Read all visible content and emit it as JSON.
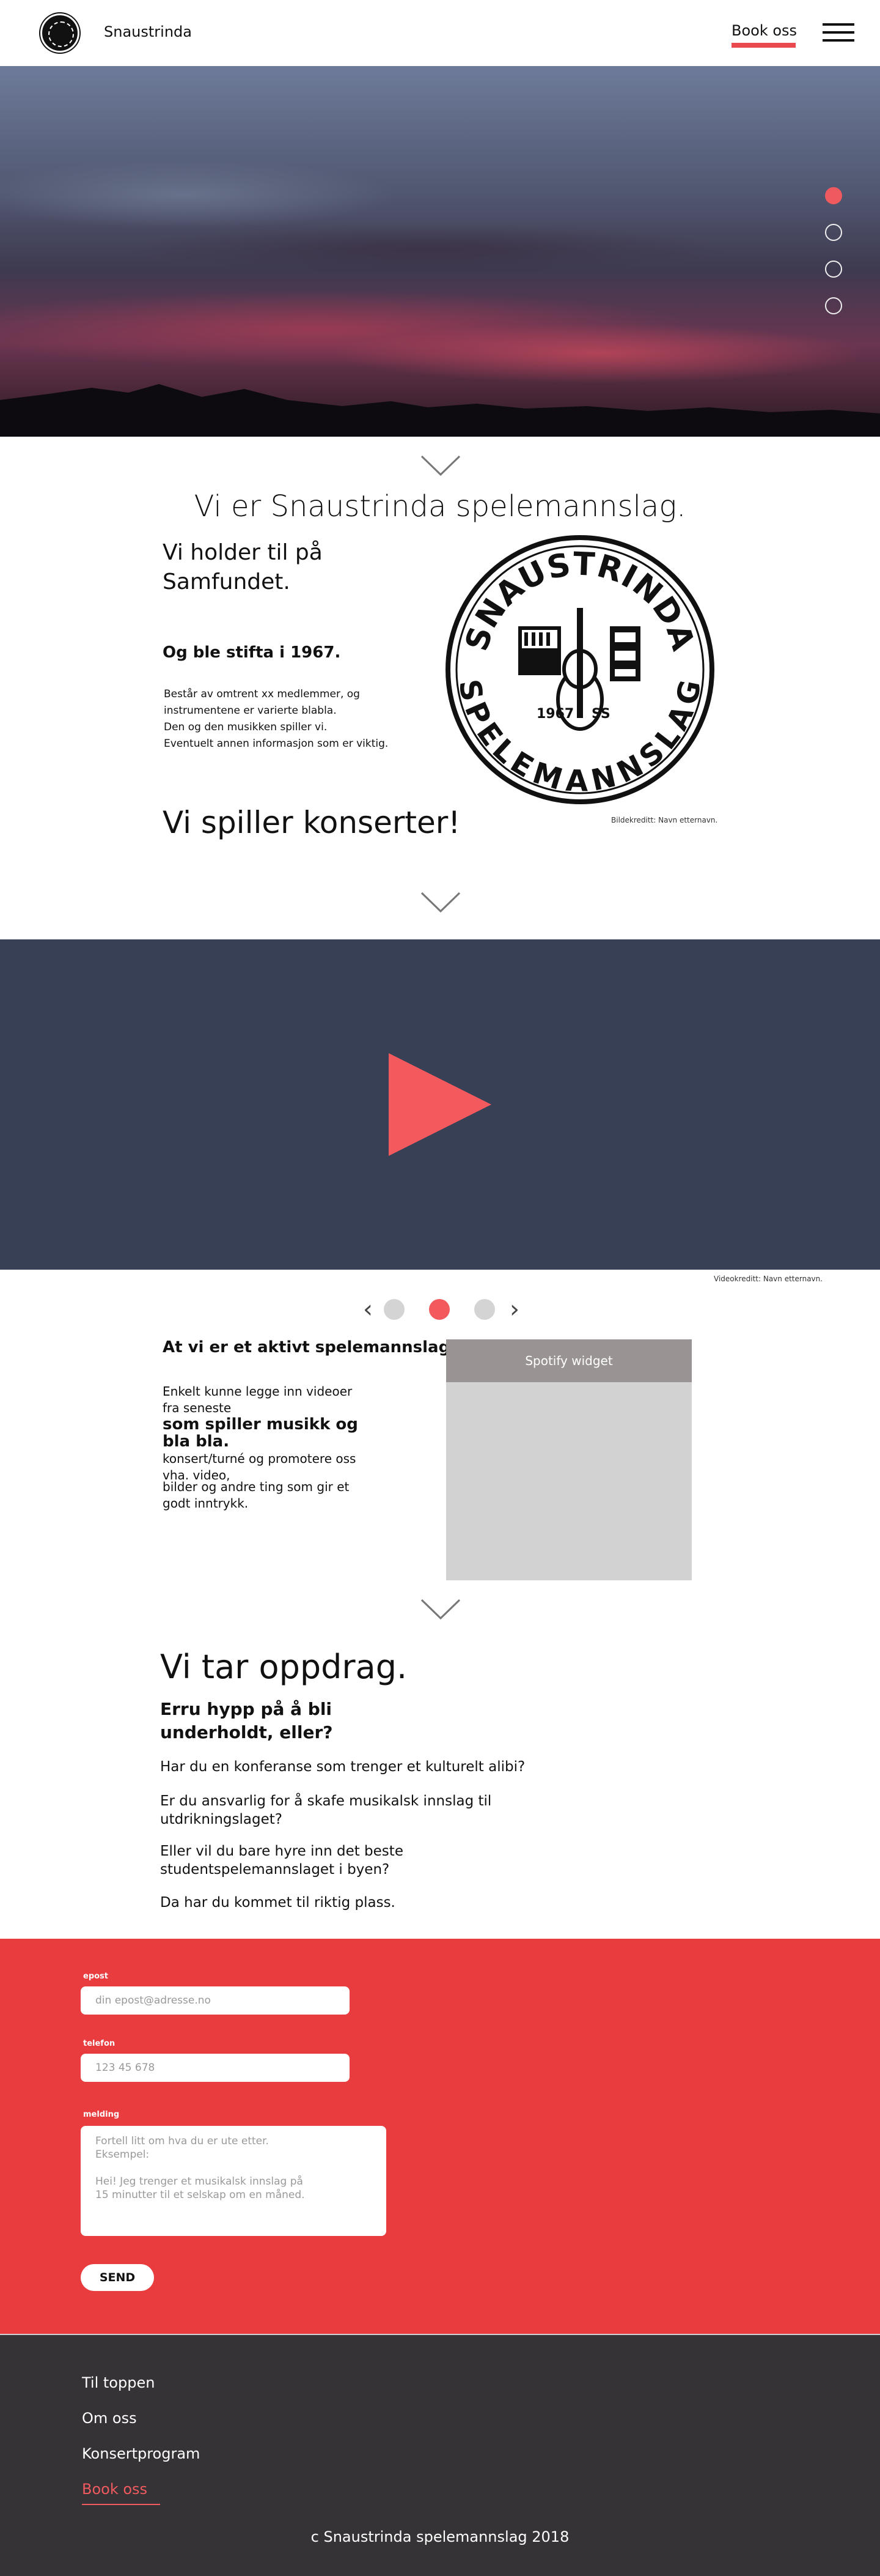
{
  "header": {
    "brand": "Snaustrinda",
    "book_label": "Book oss",
    "accent": "#e94a4f"
  },
  "hero": {
    "slide_count": 4,
    "active_slide": 1
  },
  "about": {
    "title": "Vi er Snaustrinda spelemannslag.",
    "subtitle": "Vi holder til på Samfundet.",
    "founded": "Og ble stifta i 1967.",
    "lines": [
      "Består av omtrent xx medlemmer, og",
      "instrumentene er varierte blabla.",
      "Den og den musikken spiller vi.",
      "Eventuelt annen informasjon som er viktig."
    ],
    "image_credit": "Bildekreditt: Navn etternavn.",
    "concerts": "Vi spiller konserter!",
    "seal": {
      "top_text": "SNAUSTRINDA",
      "bottom_text": "SPELEMANNSLAG",
      "year": "1967",
      "initials": "SS"
    }
  },
  "video": {
    "background": "#374055",
    "play_color": "#f25a5d",
    "credit": "Videokreditt: Navn etternavn.",
    "carousel_count": 3,
    "carousel_active": 2
  },
  "active": {
    "title": "At vi er et aktivt spelemannslag",
    "line1": "Enkelt kunne legge inn videoer",
    "line2": "fra seneste",
    "bold": "som spiller musikk og  bla bla.",
    "line3": "konsert/turné og promotere oss",
    "line4": "vha. video,",
    "line5": "bilder og andre ting som gir et",
    "line6": "godt inntrykk.",
    "spotify_label": "Spotify widget"
  },
  "oppdrag": {
    "title": "Vi tar oppdrag.",
    "subtitle": "Erru hypp på å bli underholdt, eller?",
    "p1": "Har du en konferanse som trenger et kulturelt alibi?",
    "p2": "Er du ansvarlig for å skafe musikalsk innslag til utdrikningslaget?",
    "p3": "Eller vil du bare hyre inn det beste studentspelemannslaget i byen?",
    "p4": "Da har du kommet til riktig plass."
  },
  "form": {
    "background": "#e83c3f",
    "email_label": "epost",
    "email_placeholder": "din epost@adresse.no",
    "phone_label": "telefon",
    "phone_placeholder": "123 45 678",
    "message_label": "melding",
    "message_placeholder": "Fortell litt om hva du er ute etter.\nEksempel:\n\nHei! Jeg trenger et musikalsk innslag på\n15 minutter til et selskap om en måned.",
    "send_label": "SEND"
  },
  "footer": {
    "background": "#353335",
    "links": [
      "Til toppen",
      "Om oss",
      "Konsertprogram",
      "Book oss"
    ],
    "copyright": "c Snaustrinda spelemannslag 2018"
  }
}
